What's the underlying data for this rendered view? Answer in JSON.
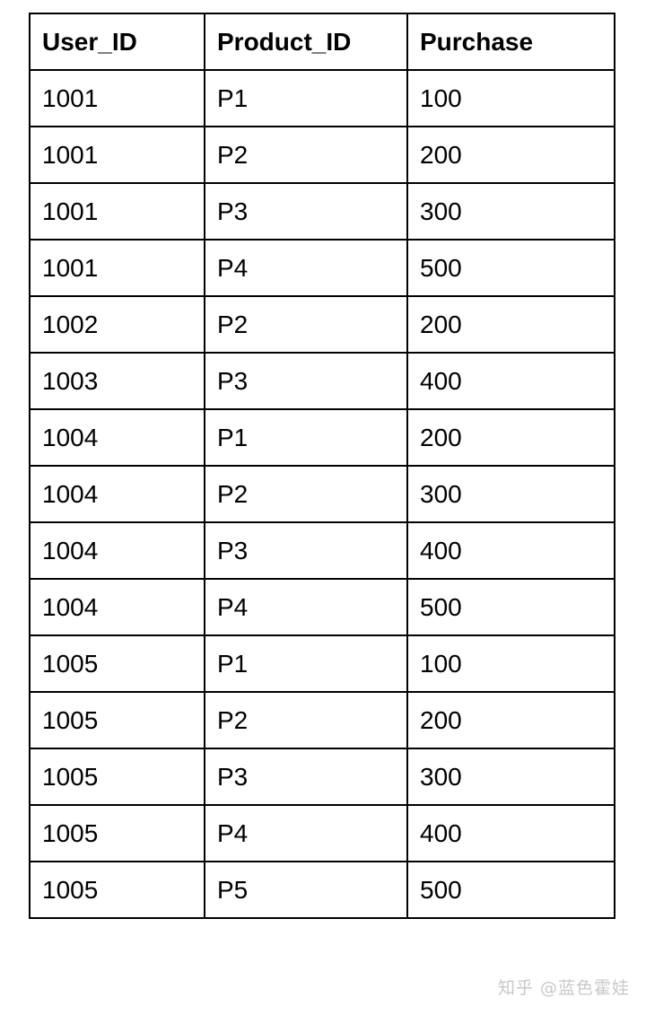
{
  "table": {
    "headers": [
      "User_ID",
      "Product_ID",
      "Purchase"
    ],
    "rows": [
      [
        "1001",
        "P1",
        "100"
      ],
      [
        "1001",
        "P2",
        "200"
      ],
      [
        "1001",
        "P3",
        "300"
      ],
      [
        "1001",
        "P4",
        "500"
      ],
      [
        "1002",
        "P2",
        "200"
      ],
      [
        "1003",
        "P3",
        "400"
      ],
      [
        "1004",
        "P1",
        "200"
      ],
      [
        "1004",
        "P2",
        "300"
      ],
      [
        "1004",
        "P3",
        "400"
      ],
      [
        "1004",
        "P4",
        "500"
      ],
      [
        "1005",
        "P1",
        "100"
      ],
      [
        "1005",
        "P2",
        "200"
      ],
      [
        "1005",
        "P3",
        "300"
      ],
      [
        "1005",
        "P4",
        "400"
      ],
      [
        "1005",
        "P5",
        "500"
      ]
    ]
  },
  "watermark": "知乎 @蓝色霍娃"
}
